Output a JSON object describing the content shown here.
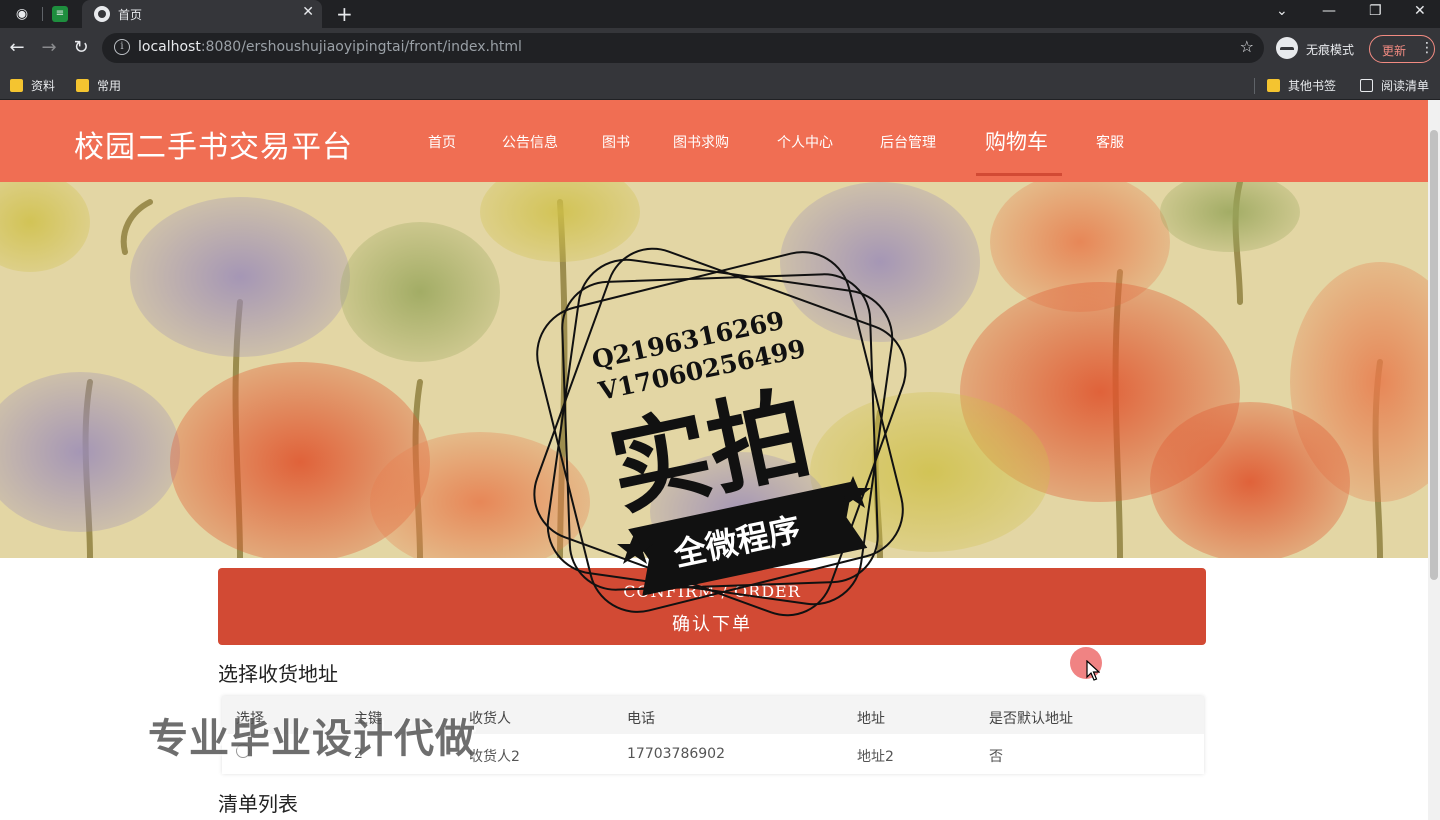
{
  "browser": {
    "tab_title": "首页",
    "url_host": "localhost",
    "url_rest": ":8080/ershoushujiaoyipingtai/front/index.html",
    "incognito_label": "无痕模式",
    "update_label": "更新",
    "bookmarks": [
      "资料",
      "常用"
    ],
    "other_bookmarks": "其他书签",
    "reading_list": "阅读清单"
  },
  "site": {
    "title": "校园二手书交易平台",
    "nav": [
      "首页",
      "公告信息",
      "图书",
      "图书求购",
      "个人中心",
      "后台管理",
      "购物车",
      "客服"
    ]
  },
  "stamp": {
    "line1": "Q2196316269",
    "line2": "V17060256499",
    "main": "实拍",
    "ribbon": "全微程序"
  },
  "confirm": {
    "en": "CONFIRM / ORDER",
    "zh": "确认下单"
  },
  "address_section": {
    "title": "选择收货地址",
    "columns": [
      "选择",
      "主键",
      "收货人",
      "电话",
      "地址",
      "是否默认地址"
    ],
    "rows": [
      {
        "id": "2",
        "name": "收货人2",
        "phone": "17703786902",
        "address": "地址2",
        "is_default": "否"
      }
    ]
  },
  "list_section": {
    "title": "清单列表"
  },
  "watermark": "专业毕业设计代做",
  "colors": {
    "header": "#f06e53",
    "confirm_button": "#d24a34",
    "banner_bg": "#e3d6a4"
  }
}
